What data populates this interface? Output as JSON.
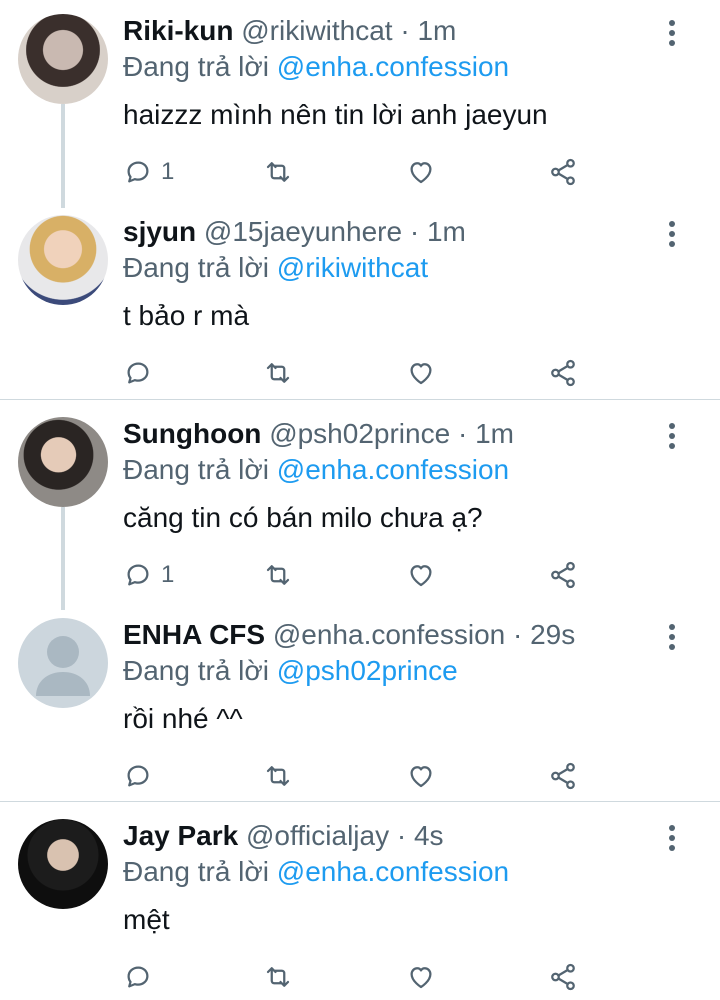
{
  "reply_prefix": "Đang trả lời",
  "tweets": [
    {
      "name": "Riki-kun",
      "handle": "@rikiwithcat",
      "time": "1m",
      "reply_to": "@enha.confession",
      "text": "haizzz mình nên tin lời anh jaeyun",
      "reply_count": "1",
      "avatar": "photo-avatar"
    },
    {
      "name": "sjyun",
      "handle": "@15jaeyunhere",
      "time": "1m",
      "reply_to": "@rikiwithcat",
      "text": "t bảo r mà",
      "reply_count": "",
      "avatar": "photo-avatar"
    },
    {
      "name": "Sunghoon",
      "handle": "@psh02prince",
      "time": "1m",
      "reply_to": "@enha.confession",
      "text": "căng tin có bán milo chưa ạ?",
      "reply_count": "1",
      "avatar": "photo-avatar"
    },
    {
      "name": "ENHA CFS",
      "handle": "@enha.confession",
      "time": "29s",
      "reply_to": "@psh02prince",
      "text": "rồi nhé ^^",
      "reply_count": "",
      "avatar": "default-avatar"
    },
    {
      "name": "Jay Park",
      "handle": "@officialjay",
      "time": "4s",
      "reply_to": "@enha.confession",
      "text": "mệt",
      "reply_count": "",
      "avatar": "photo-avatar"
    }
  ],
  "colors": {
    "link": "#1d9bf0",
    "secondary": "#536471",
    "line": "#cfd9de"
  }
}
